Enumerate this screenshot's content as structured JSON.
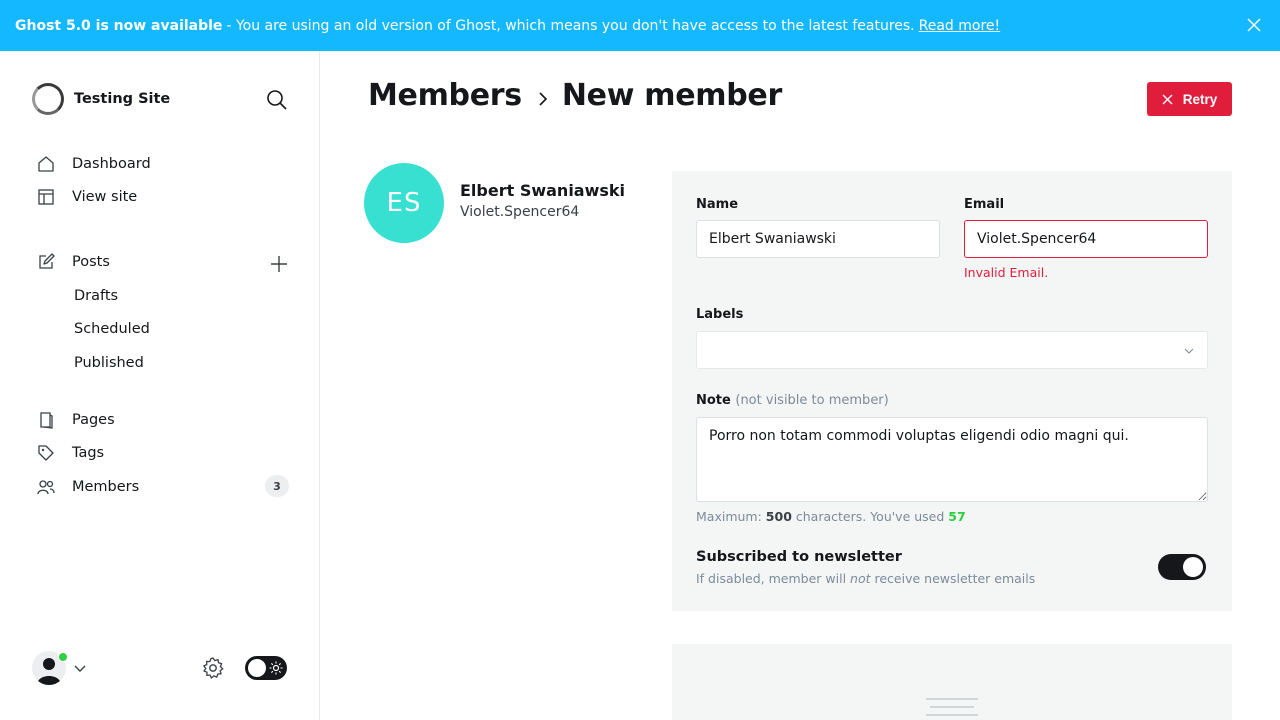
{
  "banner": {
    "title": "Ghost 5.0 is now available",
    "message": "- You are using an old version of Ghost, which means you don't have access to the latest features.",
    "link": "Read more!"
  },
  "sidebar": {
    "site_name": "Testing Site",
    "nav": [
      {
        "label": "Dashboard",
        "icon": "home-icon"
      },
      {
        "label": "View site",
        "icon": "view-site-icon"
      },
      {
        "label": "Posts",
        "icon": "posts-icon"
      },
      {
        "label": "Pages",
        "icon": "pages-icon"
      },
      {
        "label": "Tags",
        "icon": "tag-icon"
      },
      {
        "label": "Members",
        "icon": "members-icon"
      }
    ],
    "post_subitems": [
      "Drafts",
      "Scheduled",
      "Published"
    ],
    "members_count": "3"
  },
  "header": {
    "breadcrumb_parent": "Members",
    "breadcrumb_current": "New member",
    "retry_label": "Retry"
  },
  "member": {
    "initials": "ES",
    "name": "Elbert Swaniawski",
    "email": "Violet.Spencer64",
    "avatar_color": "#37e0d0"
  },
  "form": {
    "name_label": "Name",
    "name_value": "Elbert Swaniawski",
    "email_label": "Email",
    "email_value": "Violet.Spencer64",
    "email_error": "Invalid Email.",
    "labels_label": "Labels",
    "note_label": "Note",
    "note_hint": "(not visible to member)",
    "note_value": "Porro non totam commodi voluptas eligendi odio magni qui.",
    "count_prefix": "Maximum:",
    "count_max": "500",
    "count_middle": "characters. You've used",
    "count_used": "57",
    "newsletter_title": "Subscribed to newsletter",
    "newsletter_desc_a": "If disabled, member will",
    "newsletter_desc_em": "not",
    "newsletter_desc_b": "receive newsletter emails",
    "newsletter_enabled": true
  },
  "colors": {
    "banner": "#14b8ff",
    "danger": "#e11d3c",
    "success": "#30cf43"
  }
}
